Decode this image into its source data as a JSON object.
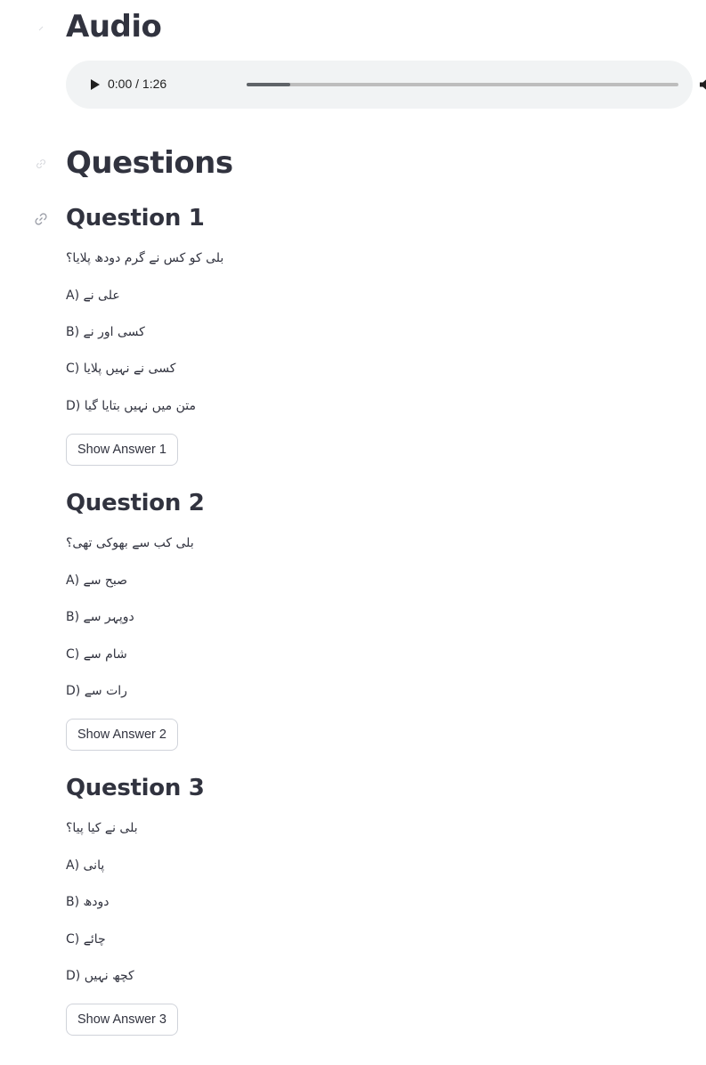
{
  "audio_section": {
    "heading": "Audio",
    "player": {
      "time_display": "0:00 / 1:26",
      "progress_fraction": 0.0,
      "buffered_fraction": 0.1,
      "icons": [
        "play-icon",
        "volume-icon",
        "more-vert-icon"
      ]
    }
  },
  "questions_section": {
    "heading": "Questions",
    "questions": [
      {
        "title": "Question 1",
        "prompt": "بلی کو کس نے گرم دودھ پلایا؟",
        "options": [
          "A) علی نے",
          "B) کسی اور نے",
          "C) کسی نے نہیں پلایا",
          "D) متن میں نہیں بتایا گیا"
        ],
        "button_label": "Show Answer 1"
      },
      {
        "title": "Question 2",
        "prompt": "بلی کب سے بھوکی تھی؟",
        "options": [
          "A) صبح سے",
          "B) دوپہر سے",
          "C) شام سے",
          "D) رات سے"
        ],
        "button_label": "Show Answer 2"
      },
      {
        "title": "Question 3",
        "prompt": "بلی نے کیا پیا؟",
        "options": [
          "A) پانی",
          "B) دودھ",
          "C) چائے",
          "D) کچھ نہیں"
        ],
        "button_label": "Show Answer 3"
      }
    ]
  },
  "colors": {
    "text": "#31333f",
    "player_bg": "#f1f3f4",
    "button_border": "#d0d3da",
    "anchor_icon": "#b0b3bb"
  }
}
